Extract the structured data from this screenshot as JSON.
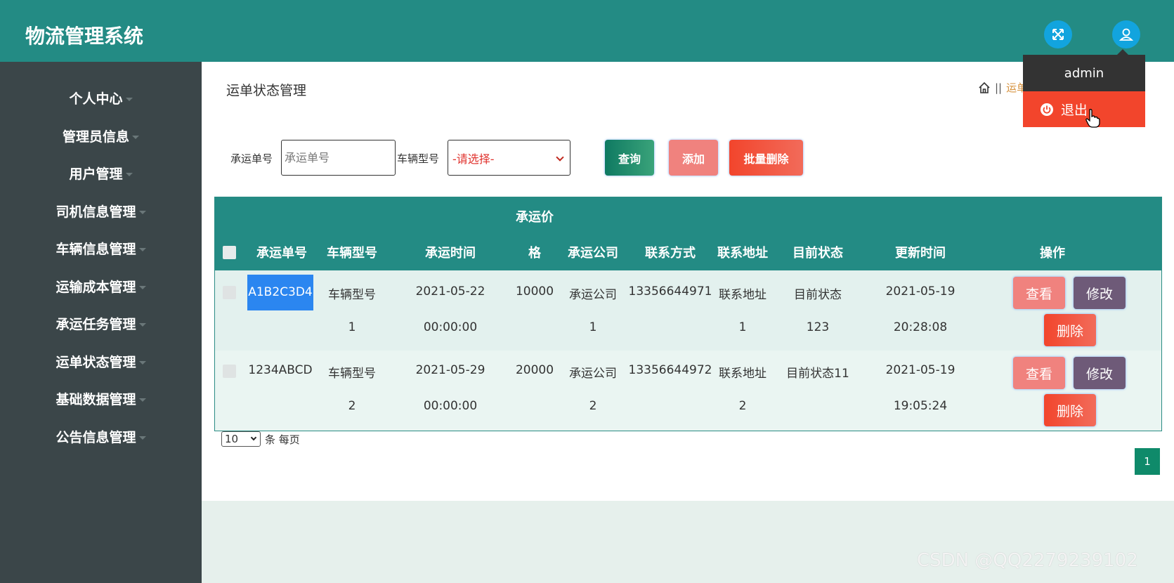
{
  "app": {
    "title": "物流管理系统"
  },
  "header": {
    "fullscreen_icon": "fullscreen-icon",
    "user_icon": "user-icon"
  },
  "user_menu": {
    "username": "admin",
    "logout_label": "退出",
    "logout_icon": "power-icon"
  },
  "sidebar": {
    "items": [
      {
        "label": "个人中心"
      },
      {
        "label": "管理员信息"
      },
      {
        "label": "用户管理"
      },
      {
        "label": "司机信息管理"
      },
      {
        "label": "车辆信息管理"
      },
      {
        "label": "运输成本管理"
      },
      {
        "label": "承运任务管理"
      },
      {
        "label": "运单状态管理"
      },
      {
        "label": "基础数据管理"
      },
      {
        "label": "公告信息管理"
      }
    ]
  },
  "page": {
    "title": "运单状态管理",
    "breadcrumb": {
      "home_icon": "home-icon",
      "separator": "||",
      "current": "运单"
    }
  },
  "search": {
    "order_no_label": "承运单号",
    "order_no_placeholder": "承运单号",
    "vehicle_type_label": "车辆型号",
    "vehicle_type_selected": "-请选择-",
    "query_button": "查询",
    "add_button": "添加",
    "batch_delete_button": "批量删除"
  },
  "table": {
    "columns": {
      "order_no": "承运单号",
      "vehicle_type": "车辆型号",
      "ship_time": "承运时间",
      "price_line1": "承运价",
      "price_line2": "格",
      "company": "承运公司",
      "contact": "联系方式",
      "address": "联系地址",
      "status": "目前状态",
      "update_time": "更新时间",
      "actions": "操作"
    },
    "rows": [
      {
        "order_no": "A1B2C3D4",
        "vehicle_type_1": "车辆型号",
        "vehicle_type_2": "1",
        "ship_date": "2021-05-22",
        "ship_clock": "00:00:00",
        "price": "10000",
        "company_1": "承运公司",
        "company_2": "1",
        "contact": "13356644971",
        "address_1": "联系地址",
        "address_2": "1",
        "status_1": "目前状态",
        "status_2": "123",
        "update_date": "2021-05-19",
        "update_clock": "20:28:08",
        "view": "查看",
        "edit": "修改",
        "delete": "删除"
      },
      {
        "order_no": "1234ABCD",
        "vehicle_type_1": "车辆型号",
        "vehicle_type_2": "2",
        "ship_date": "2021-05-29",
        "ship_clock": "00:00:00",
        "price": "20000",
        "company_1": "承运公司",
        "company_2": "2",
        "contact": "13356644972",
        "address_1": "联系地址",
        "address_2": "2",
        "status_1": "目前状态11",
        "status_2": "",
        "update_date": "2021-05-19",
        "update_clock": "19:05:24",
        "view": "查看",
        "edit": "修改",
        "delete": "删除"
      }
    ]
  },
  "pagination": {
    "page_size": "10",
    "page_size_suffix": "条 每页",
    "current_page": "1"
  },
  "watermark": "CSDN @QQ2279239102",
  "colors": {
    "header": "#238b84",
    "sidebar": "#3b4649",
    "query": "#14876a",
    "add": "#f0827e",
    "batch_delete": "#f25a3c",
    "view": "#f0827e",
    "edit": "#6e5a78",
    "delete": "#f2452c"
  }
}
